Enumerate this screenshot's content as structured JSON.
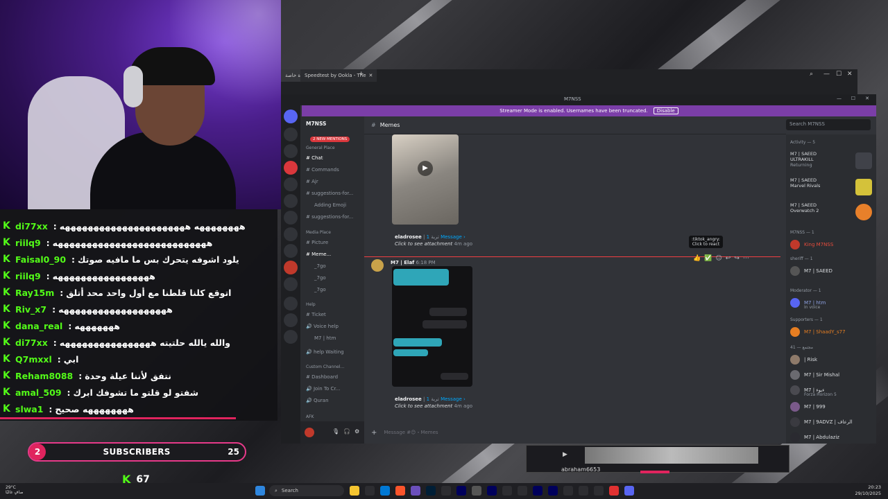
{
  "stream": {
    "chat": [
      {
        "user": "di77xx",
        "msg": "ههههههههه ههههههههههههههههههههههه"
      },
      {
        "user": "riilq9",
        "msg": "هههههههههههههههههههههههههههه"
      },
      {
        "user": "Faisal0_90",
        "msg": "يلود اشوفه يتحرك بس ما مافيه صوتك"
      },
      {
        "user": "riilq9",
        "msg": "هههههههههههههههههه"
      },
      {
        "user": "Ray15m",
        "msg": "اتوقع كلنا قلطنا مع أول واحد محد أتلق"
      },
      {
        "user": "Riv_x7",
        "msg": "هههههههههههههههههههه"
      },
      {
        "user": "dana_real",
        "msg": "هههههههه"
      },
      {
        "user": "di77xx",
        "msg": "والله يالله حلتيته ههههههههههههههههه"
      },
      {
        "user": "Q7mxxl",
        "msg": "ابي"
      },
      {
        "user": "Reham8088",
        "msg": "نتفق لأننا عيلة وحدة"
      },
      {
        "user": "amal_509",
        "msg": "شفتو لو قلتو ما تشوفك ابرك"
      },
      {
        "user": "slwa1",
        "msg": "ههههههههه صحيح"
      }
    ],
    "subscribers": {
      "badge": "2",
      "label": "SUBSCRIBERS",
      "count": "25"
    },
    "kick_count": "67"
  },
  "browser": {
    "tab1": "قناة خاصة",
    "tab2": "Speedtest by Ookla - The"
  },
  "discord": {
    "title": "M7NSS",
    "banner": "Streamer Mode is enabled. Usernames have been truncated.",
    "banner_btn": "Disable",
    "server_name": "M7NSS",
    "mentions": "2 NEW MENTIONS",
    "categories": {
      "general": "General Place",
      "media": "Media Place",
      "help": "Help",
      "custom": "Custom Channel...",
      "afk": "AFK"
    },
    "channels": {
      "chat": "Chat",
      "commands": "Commands",
      "ajr": "Ajr",
      "suggestions": "suggestions-for...",
      "adding_emoji": "Adding Emoji",
      "suggestions2": "suggestions-for...",
      "picture": "Picture",
      "memes": "Meme...",
      "t1": "_7go",
      "t2": "_7go",
      "t3": "_7go",
      "ticket": "Ticket",
      "voice_help": "Voice help",
      "m7htm": "M7 | htm",
      "help_waiting": "help Waiting",
      "dashboard": "Dashboard",
      "join": "Join To Cr...",
      "quran": "Quran"
    },
    "header_channel": "Memes",
    "search": "Search M7NSS",
    "msg1": {
      "user": "eladrosee",
      "sep": "| تربة",
      "link": "1 Message ›",
      "click": "Click to see attachment",
      "time": "4m ago"
    },
    "msg2_author": "M7 | Elaf",
    "msg2_time": "6:18 PM",
    "msg3": {
      "user": "eladrosee",
      "sep": "| تربة",
      "link": "1 Message ›",
      "click": "Click to see attachment",
      "time": "4m ago"
    },
    "tooltip1": ":tiktok_angry:",
    "tooltip2": "Click to react",
    "input_placeholder": "Message #😊・Memes",
    "members": {
      "activity": "Activity — 5",
      "act1_name": "M7 | SAEED",
      "act1_game": "ULTRAKILL",
      "act1_status": "Returning",
      "act2_name": "M7 | SAEED",
      "act2_game": "Marvel Rivals",
      "act3_name": "M7 | SAEED",
      "act3_game": "Overwatch 2",
      "cat1": "M7NSS — 1",
      "m1": "King M7NSS",
      "cat2": "sheriff — 1",
      "m2": "M7 | SAEED",
      "cat3": "Moderator — 1",
      "m3": "M7 | htm",
      "m3_sub": "In voice",
      "cat4": "Supporters — 1",
      "m4": "M7 | ShaadY_s77",
      "cat5": "مجتمع — 41",
      "m5": "| Risk",
      "m6": "M7 | Sir Mishal",
      "m7": "M7 | ءيوء",
      "m7_sub": "Forza Horizon 5",
      "m8": "M7 | 999",
      "m9": "M7 | 9ADVZ | الرعاف",
      "m10": "M7 | Abdulaziz"
    }
  },
  "mini_video": {
    "name": "abraham6653"
  },
  "taskbar": {
    "weather": "29°C",
    "weather_sub": "صافٍ غالبًا",
    "search": "Search",
    "time": "20:23",
    "date": "29/10/2025"
  },
  "colors": {
    "kick_green": "#53fc18",
    "discord_bg": "#313338",
    "accent_pink": "#e83a8a",
    "streamer_banner": "#7b3ea8"
  }
}
